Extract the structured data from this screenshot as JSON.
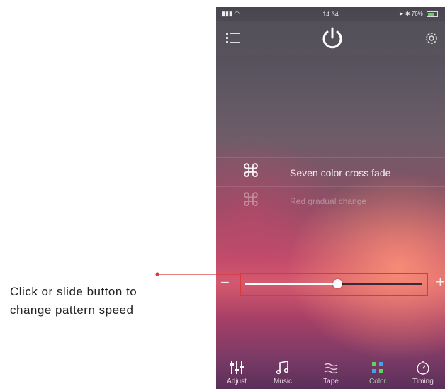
{
  "status_bar": {
    "time": "14:34",
    "battery": "76%"
  },
  "patterns": [
    {
      "label": "Seven color cross fade"
    },
    {
      "label": "Red gradual change"
    }
  ],
  "speed": {
    "minus": "−",
    "plus": "+",
    "value_fraction": 0.52
  },
  "tabs": [
    {
      "label": "Adjust",
      "icon": "sliders-icon"
    },
    {
      "label": "Music",
      "icon": "music-note-icon"
    },
    {
      "label": "Tape",
      "icon": "wind-icon"
    },
    {
      "label": "Color",
      "icon": "color-grid-icon"
    },
    {
      "label": "Timing",
      "icon": "timer-icon"
    }
  ],
  "annotation": {
    "line1": "Click or slide button to",
    "line2": "change pattern speed",
    "color": "#d83a3a"
  }
}
